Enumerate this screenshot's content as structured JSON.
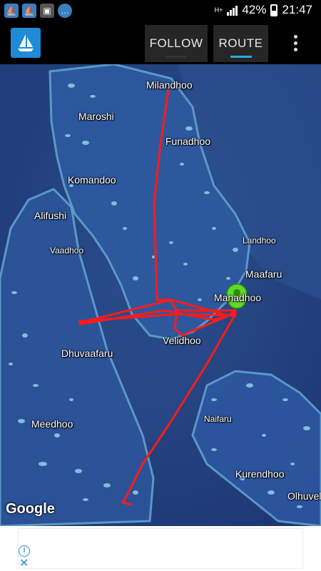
{
  "status_bar": {
    "notification_icons": [
      "sailboat-icon",
      "sailboat-icon",
      "image-icon",
      "chat-icon"
    ],
    "network_type": "H+",
    "battery_percent": "42%",
    "time": "21:47"
  },
  "app_bar": {
    "logo": "sailboat-icon",
    "tabs": [
      {
        "label": "FOLLOW",
        "selected": false
      },
      {
        "label": "ROUTE",
        "selected": true
      }
    ],
    "overflow_menu": "more-vert-icon"
  },
  "map": {
    "places": {
      "milandhoo": "Milandhoo",
      "maroshi": "Maroshi",
      "funadhoo": "Funadhoo",
      "komandoo": "Komandoo",
      "alifushi": "Alifushi",
      "vaadhoo": "Vaadhoo",
      "landhoo": "Landhoo",
      "maafaru": "Maafaru",
      "manadhoo": "Manadhoo",
      "velidhoo": "Velidhoo",
      "dhuvaafaru": "Dhuvaafaru",
      "naifaru": "Naifaru",
      "meedhoo": "Meedhoo",
      "kurendhoo": "Kurendhoo",
      "olhuveli": "Olhuveli"
    },
    "attribution": "Google",
    "route_color": "#ff1a1a",
    "marker_color": "#5fd92a"
  },
  "ad": {
    "info_icon": "info-icon",
    "close_icon": "close-icon"
  }
}
